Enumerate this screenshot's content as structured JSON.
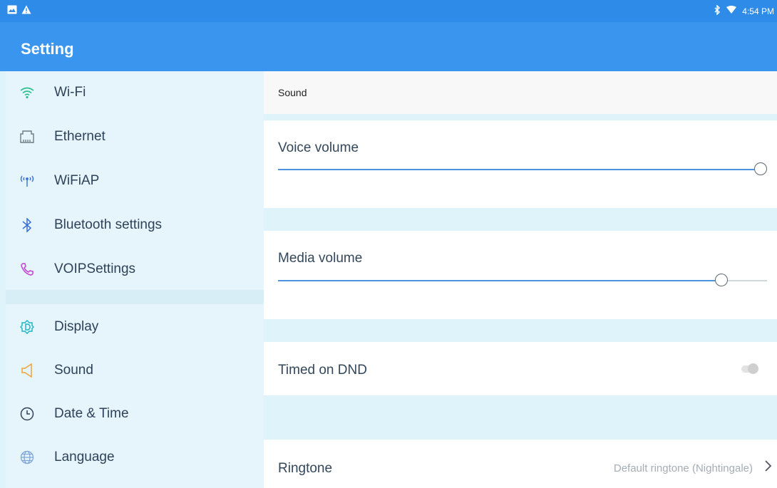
{
  "status_bar": {
    "time": "4:54 PM",
    "left_icons": [
      "image-notification-icon",
      "warning-icon"
    ],
    "right_icons": [
      "bluetooth-icon",
      "wifi-signal-icon"
    ]
  },
  "app": {
    "title": "Setting"
  },
  "sidebar": {
    "items": [
      {
        "label": "Wi-Fi",
        "icon": "wifi-icon",
        "color": "#2bbf8f"
      },
      {
        "label": "Ethernet",
        "icon": "ethernet-icon",
        "color": "#6d7b86"
      },
      {
        "label": "WiFiAP",
        "icon": "hotspot-icon",
        "color": "#3b6fd6"
      },
      {
        "label": "Bluetooth settings",
        "icon": "bluetooth-icon",
        "color": "#3b6fd6"
      },
      {
        "label": "VOIPSettings",
        "icon": "phone-icon",
        "color": "#c23fd6"
      },
      {
        "label": "Display",
        "icon": "display-icon",
        "color": "#21b5c7"
      },
      {
        "label": "Sound",
        "icon": "speaker-icon",
        "color": "#f0a23a"
      },
      {
        "label": "Date & Time",
        "icon": "clock-icon",
        "color": "#2f4259"
      },
      {
        "label": "Language",
        "icon": "globe-icon",
        "color": "#7fa5d9"
      }
    ]
  },
  "main": {
    "section_title": "Sound",
    "voice_volume": {
      "label": "Voice volume",
      "level": 1.0
    },
    "media_volume": {
      "label": "Media volume",
      "level": 0.918
    },
    "timed_dnd": {
      "label": "Timed on DND",
      "enabled": false
    },
    "ringtone": {
      "label": "Ringtone",
      "value": "Default ringtone (Nightingale)"
    }
  }
}
